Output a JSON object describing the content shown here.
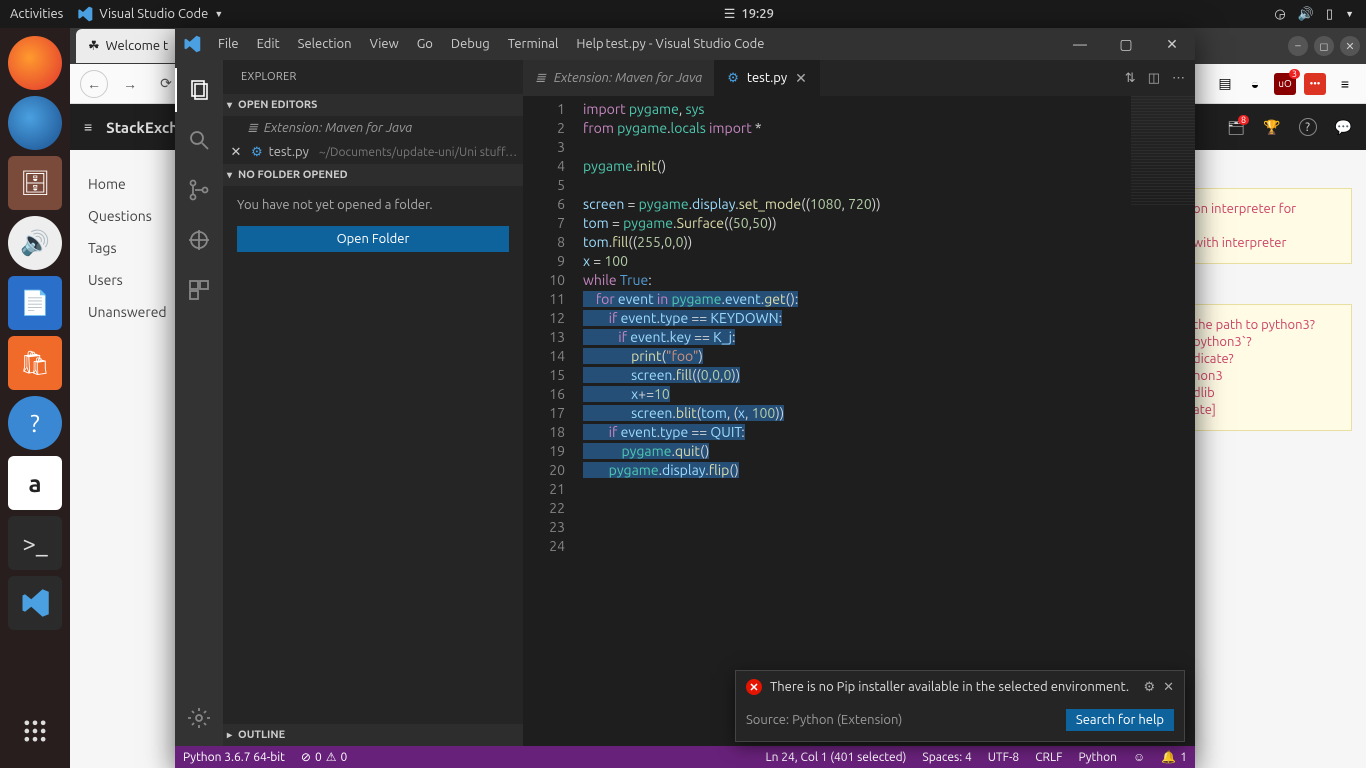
{
  "gnome": {
    "activities": "Activities",
    "app_menu": "Visual Studio Code",
    "clock": "19:29"
  },
  "firefox": {
    "tab_title": "Welcome t",
    "site_brand": "StackExcha",
    "leftnav": [
      "Home",
      "Questions",
      "Tags",
      "Users",
      "Unanswered"
    ],
    "right_snip1a": "on interpreter for",
    "right_snip1b": "with interpreter",
    "right_snips": [
      "the path to python3?",
      "python3`?",
      "dicate?",
      "hon3",
      "dlib",
      "ate]"
    ],
    "inbox_badge": "8",
    "ublock_badge": "3"
  },
  "vscode": {
    "menu": [
      "File",
      "Edit",
      "Selection",
      "View",
      "Go",
      "Debug",
      "Terminal",
      "Help"
    ],
    "title": "test.py - Visual Studio Code",
    "explorer": {
      "title": "EXPLORER",
      "open_editors": "OPEN EDITORS",
      "item1": "Extension: Maven for Java",
      "item2_name": "test.py",
      "item2_path": "~/Documents/update-uni/Uni stuff…",
      "no_folder": "NO FOLDER OPENED",
      "no_folder_msg": "You have not yet opened a folder.",
      "open_folder_btn": "Open Folder",
      "outline": "OUTLINE"
    },
    "tabs": {
      "t1": "Extension: Maven for Java",
      "t2": "test.py"
    },
    "code_lines": [
      {
        "n": 1,
        "raw": "import pygame, sys",
        "tokens": [
          [
            "kw",
            "import"
          ],
          [
            "txt",
            " "
          ],
          [
            "mod",
            "pygame"
          ],
          [
            "txt",
            ", "
          ],
          [
            "mod",
            "sys"
          ]
        ]
      },
      {
        "n": 2,
        "raw": "from pygame.locals import *",
        "tokens": [
          [
            "kw",
            "from"
          ],
          [
            "txt",
            " "
          ],
          [
            "mod",
            "pygame"
          ],
          [
            "txt",
            "."
          ],
          [
            "mod",
            "locals"
          ],
          [
            "txt",
            " "
          ],
          [
            "kw",
            "import"
          ],
          [
            "txt",
            " *"
          ]
        ]
      },
      {
        "n": 3,
        "raw": "",
        "tokens": []
      },
      {
        "n": 4,
        "raw": "pygame.init()",
        "tokens": [
          [
            "mod",
            "pygame"
          ],
          [
            "txt",
            "."
          ],
          [
            "fn",
            "init"
          ],
          [
            "txt",
            "()"
          ]
        ]
      },
      {
        "n": 5,
        "raw": "",
        "tokens": []
      },
      {
        "n": 6,
        "raw": "screen = pygame.display.set_mode((1080, 720))",
        "tokens": [
          [
            "id",
            "screen"
          ],
          [
            "txt",
            " = "
          ],
          [
            "mod",
            "pygame"
          ],
          [
            "txt",
            "."
          ],
          [
            "id",
            "display"
          ],
          [
            "txt",
            "."
          ],
          [
            "fn",
            "set_mode"
          ],
          [
            "txt",
            "(("
          ],
          [
            "num",
            "1080"
          ],
          [
            "txt",
            ", "
          ],
          [
            "num",
            "720"
          ],
          [
            "txt",
            "))"
          ]
        ]
      },
      {
        "n": 7,
        "raw": "tom = pygame.Surface((50,50))",
        "tokens": [
          [
            "id",
            "tom"
          ],
          [
            "txt",
            " = "
          ],
          [
            "mod",
            "pygame"
          ],
          [
            "txt",
            "."
          ],
          [
            "fn",
            "Surface"
          ],
          [
            "txt",
            "(("
          ],
          [
            "num",
            "50"
          ],
          [
            "txt",
            ","
          ],
          [
            "num",
            "50"
          ],
          [
            "txt",
            "))"
          ]
        ]
      },
      {
        "n": 8,
        "raw": "tom.fill((255,0,0))",
        "tokens": [
          [
            "id",
            "tom"
          ],
          [
            "txt",
            "."
          ],
          [
            "fn",
            "fill"
          ],
          [
            "txt",
            "(("
          ],
          [
            "num",
            "255"
          ],
          [
            "txt",
            ","
          ],
          [
            "num",
            "0"
          ],
          [
            "txt",
            ","
          ],
          [
            "num",
            "0"
          ],
          [
            "txt",
            "))"
          ]
        ]
      },
      {
        "n": 9,
        "raw": "",
        "tokens": [],
        "hl": true
      },
      {
        "n": 10,
        "raw": "x = 100",
        "tokens": [
          [
            "id",
            "x"
          ],
          [
            "txt",
            " = "
          ],
          [
            "num",
            "100"
          ]
        ]
      },
      {
        "n": 11,
        "raw": "while True:",
        "tokens": [
          [
            "kw",
            "while"
          ],
          [
            "txt",
            " "
          ],
          [
            "const",
            "True"
          ],
          [
            "txt",
            ":"
          ]
        ]
      },
      {
        "n": 12,
        "raw": "",
        "tokens": [],
        "hl": true
      },
      {
        "n": 13,
        "raw": "    for event in pygame.event.get():",
        "tokens": [
          [
            "txt",
            "    "
          ],
          [
            "kw",
            "for"
          ],
          [
            "txt",
            " "
          ],
          [
            "id",
            "event"
          ],
          [
            "txt",
            " "
          ],
          [
            "kw",
            "in"
          ],
          [
            "txt",
            " "
          ],
          [
            "mod",
            "pygame"
          ],
          [
            "txt",
            "."
          ],
          [
            "id",
            "event"
          ],
          [
            "txt",
            "."
          ],
          [
            "fn",
            "get"
          ],
          [
            "txt",
            "():"
          ]
        ],
        "hl": true
      },
      {
        "n": 14,
        "raw": "        if event.type == KEYDOWN:",
        "tokens": [
          [
            "txt",
            "        "
          ],
          [
            "kw",
            "if"
          ],
          [
            "txt",
            " "
          ],
          [
            "id",
            "event"
          ],
          [
            "txt",
            "."
          ],
          [
            "id",
            "type"
          ],
          [
            "txt",
            " == "
          ],
          [
            "id",
            "KEYDOWN"
          ],
          [
            "txt",
            ":"
          ]
        ],
        "hl": true
      },
      {
        "n": 15,
        "raw": "           if event.key == K_j:",
        "tokens": [
          [
            "txt",
            "           "
          ],
          [
            "kw",
            "if"
          ],
          [
            "txt",
            " "
          ],
          [
            "id",
            "event"
          ],
          [
            "txt",
            "."
          ],
          [
            "id",
            "key"
          ],
          [
            "txt",
            " == "
          ],
          [
            "id",
            "K_j"
          ],
          [
            "txt",
            ":"
          ]
        ],
        "hl": true
      },
      {
        "n": 16,
        "raw": "               print(\"foo\")",
        "tokens": [
          [
            "txt",
            "               "
          ],
          [
            "fn",
            "print"
          ],
          [
            "txt",
            "("
          ],
          [
            "str",
            "\"foo\""
          ],
          [
            "txt",
            ")"
          ]
        ],
        "hl": true
      },
      {
        "n": 17,
        "raw": "               screen.fill((0,0,0))",
        "tokens": [
          [
            "txt",
            "               "
          ],
          [
            "id",
            "screen"
          ],
          [
            "txt",
            "."
          ],
          [
            "fn",
            "fill"
          ],
          [
            "txt",
            "(("
          ],
          [
            "num",
            "0"
          ],
          [
            "txt",
            ","
          ],
          [
            "num",
            "0"
          ],
          [
            "txt",
            ","
          ],
          [
            "num",
            "0"
          ],
          [
            "txt",
            "))"
          ]
        ],
        "hl": true
      },
      {
        "n": 18,
        "raw": "               x+=10",
        "tokens": [
          [
            "txt",
            "               "
          ],
          [
            "id",
            "x"
          ],
          [
            "txt",
            "+="
          ],
          [
            "num",
            "10"
          ]
        ],
        "hl": true
      },
      {
        "n": 19,
        "raw": "               screen.blit(tom, (x, 100))",
        "tokens": [
          [
            "txt",
            "               "
          ],
          [
            "id",
            "screen"
          ],
          [
            "txt",
            "."
          ],
          [
            "fn",
            "blit"
          ],
          [
            "txt",
            "("
          ],
          [
            "id",
            "tom"
          ],
          [
            "txt",
            ", ("
          ],
          [
            "id",
            "x"
          ],
          [
            "txt",
            ", "
          ],
          [
            "num",
            "100"
          ],
          [
            "txt",
            "))"
          ]
        ],
        "hl": true
      },
      {
        "n": 20,
        "raw": "        if event.type == QUIT:",
        "tokens": [
          [
            "txt",
            "        "
          ],
          [
            "kw",
            "if"
          ],
          [
            "txt",
            " "
          ],
          [
            "id",
            "event"
          ],
          [
            "txt",
            "."
          ],
          [
            "id",
            "type"
          ],
          [
            "txt",
            " == "
          ],
          [
            "id",
            "QUIT"
          ],
          [
            "txt",
            ":"
          ]
        ],
        "hl": true
      },
      {
        "n": 21,
        "raw": "            pygame.quit()",
        "tokens": [
          [
            "txt",
            "            "
          ],
          [
            "mod",
            "pygame"
          ],
          [
            "txt",
            "."
          ],
          [
            "fn",
            "quit"
          ],
          [
            "txt",
            "()"
          ]
        ],
        "hl": true
      },
      {
        "n": 22,
        "raw": "",
        "tokens": [],
        "hl": true
      },
      {
        "n": 23,
        "raw": "        pygame.display.flip()",
        "tokens": [
          [
            "txt",
            "        "
          ],
          [
            "mod",
            "pygame"
          ],
          [
            "txt",
            "."
          ],
          [
            "id",
            "display"
          ],
          [
            "txt",
            "."
          ],
          [
            "fn",
            "flip"
          ],
          [
            "txt",
            "()"
          ]
        ],
        "hl": true
      },
      {
        "n": 24,
        "raw": "",
        "tokens": []
      }
    ],
    "toast": {
      "msg": "There is no Pip installer available in the selected environment.",
      "source": "Source: Python (Extension)",
      "action": "Search for help"
    },
    "status": {
      "python": "Python 3.6.7 64-bit",
      "errors": "0",
      "warnings": "0",
      "pos": "Ln 24, Col 1 (401 selected)",
      "spaces": "Spaces: 4",
      "encoding": "UTF-8",
      "eol": "CRLF",
      "lang": "Python",
      "bell": "1"
    }
  }
}
